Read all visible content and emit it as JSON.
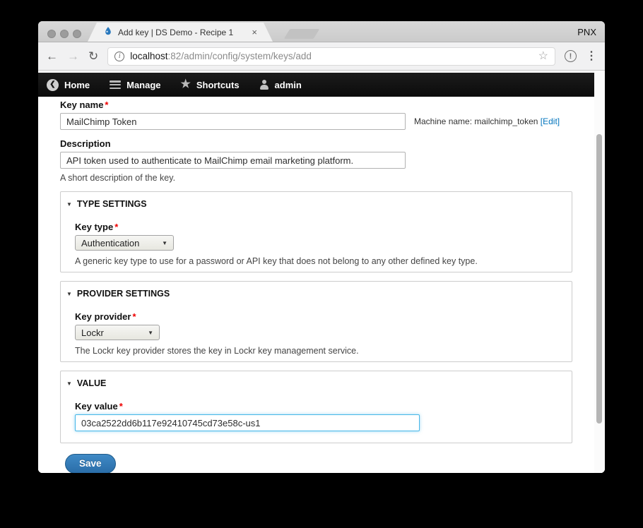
{
  "browser": {
    "tab_title": "Add key | DS Demo - Recipe 1",
    "profile_label": "PNX",
    "url_host": "localhost",
    "url_path": ":82/admin/config/system/keys/add"
  },
  "icons": {
    "back": "←",
    "forward": "→",
    "reload": "↻",
    "info": "i",
    "bookmark_star": "☆",
    "alert": "!",
    "menu_dots": "⋮",
    "tab_close": "×",
    "collapse": "▼",
    "select_caret": "▼",
    "home_chevron": "❮",
    "shortcuts_star": "★"
  },
  "admin_toolbar": {
    "items": [
      {
        "label": "Home"
      },
      {
        "label": "Manage"
      },
      {
        "label": "Shortcuts"
      },
      {
        "label": "admin"
      }
    ]
  },
  "form": {
    "key_name": {
      "label": "Key name",
      "required": "*",
      "value": "MailChimp Token",
      "machine_name": "Machine name: mailchimp_token",
      "edit_link": "[Edit]"
    },
    "description": {
      "label": "Description",
      "value": "API token used to authenticate to MailChimp email marketing platform.",
      "help": "A short description of the key."
    },
    "type_settings": {
      "legend": "TYPE SETTINGS",
      "label": "Key type",
      "required": "*",
      "selected": "Authentication",
      "help": "A generic key type to use for a password or API key that does not belong to any other defined key type."
    },
    "provider_settings": {
      "legend": "PROVIDER SETTINGS",
      "label": "Key provider",
      "required": "*",
      "selected": "Lockr",
      "help": "The Lockr key provider stores the key in Lockr key management service."
    },
    "value_section": {
      "legend": "VALUE",
      "label": "Key value",
      "required": "*",
      "value": "03ca2522dd6b117e92410745cd73e58c-us1"
    },
    "save_label": "Save"
  },
  "colors": {
    "accent_link": "#0074bd",
    "save_button": "#2a6da8",
    "required": "#ee0000",
    "toolbar_bg": "#0d0d0d",
    "focus_border": "#47b7e8"
  }
}
